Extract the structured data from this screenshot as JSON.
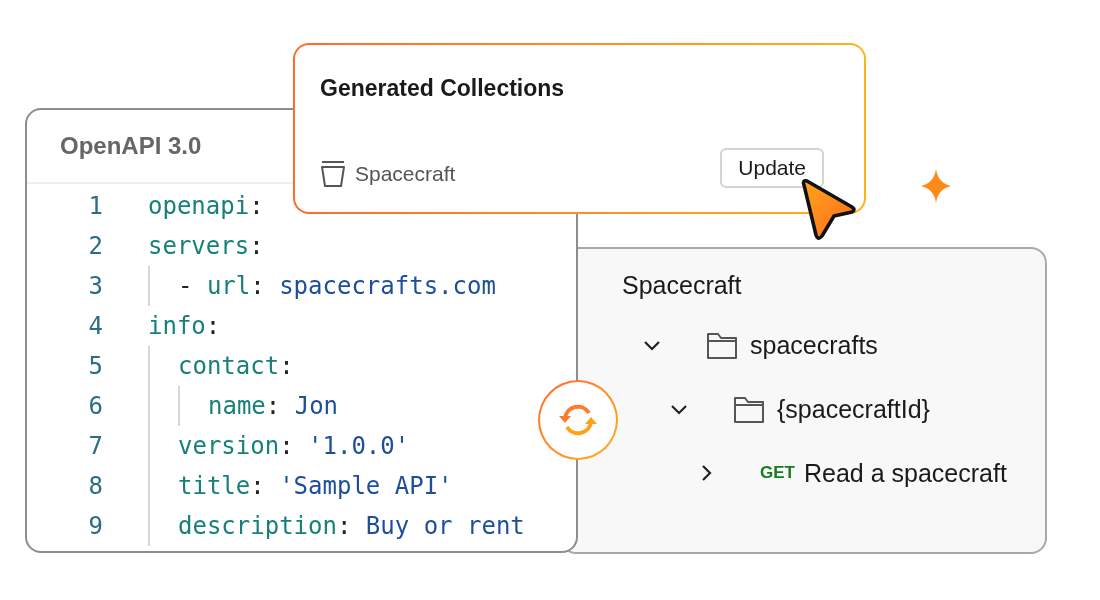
{
  "editor": {
    "title": "OpenAPI 3.0",
    "lines": [
      {
        "number": "1",
        "parts": [
          {
            "kind": "key",
            "text": "openapi"
          },
          {
            "kind": "punct",
            "text": ":"
          }
        ]
      },
      {
        "number": "2",
        "parts": [
          {
            "kind": "key",
            "text": "servers"
          },
          {
            "kind": "punct",
            "text": ":"
          }
        ],
        "children": [
          {
            "number": "3",
            "parts": [
              {
                "kind": "punct",
                "text": "- "
              },
              {
                "kind": "key",
                "text": "url"
              },
              {
                "kind": "punct",
                "text": ": "
              },
              {
                "kind": "value",
                "text": "spacecrafts.com"
              }
            ]
          }
        ]
      },
      {
        "number": "4",
        "parts": [
          {
            "kind": "key",
            "text": "info"
          },
          {
            "kind": "punct",
            "text": ":"
          }
        ],
        "children": [
          {
            "number": "5",
            "parts": [
              {
                "kind": "key",
                "text": "contact"
              },
              {
                "kind": "punct",
                "text": ":"
              }
            ],
            "children": [
              {
                "number": "6",
                "parts": [
                  {
                    "kind": "key",
                    "text": "name"
                  },
                  {
                    "kind": "punct",
                    "text": ": "
                  },
                  {
                    "kind": "value",
                    "text": "Jon"
                  }
                ]
              }
            ]
          },
          {
            "number": "7",
            "parts": [
              {
                "kind": "key",
                "text": "version"
              },
              {
                "kind": "punct",
                "text": ": "
              },
              {
                "kind": "value",
                "text": "'1.0.0'"
              }
            ]
          },
          {
            "number": "8",
            "parts": [
              {
                "kind": "key",
                "text": "title"
              },
              {
                "kind": "punct",
                "text": ": "
              },
              {
                "kind": "value",
                "text": "'Sample API'"
              }
            ]
          },
          {
            "number": "9",
            "parts": [
              {
                "kind": "key",
                "text": "description"
              },
              {
                "kind": "punct",
                "text": ": "
              },
              {
                "kind": "value",
                "text": "Buy or rent"
              }
            ]
          }
        ]
      }
    ]
  },
  "collections_card": {
    "title": "Generated Collections",
    "collection": "Spacecraft",
    "button": "Update"
  },
  "tree": {
    "title": "Spacecraft",
    "nodes": [
      {
        "kind": "folder",
        "label": "spacecrafts",
        "expanded": true,
        "children": [
          {
            "kind": "folder",
            "label": "{spacecraftId}",
            "expanded": true,
            "children": [
              {
                "kind": "request",
                "method": "GET",
                "label": "Read a spacecraft",
                "expanded": false
              }
            ]
          }
        ]
      }
    ]
  }
}
